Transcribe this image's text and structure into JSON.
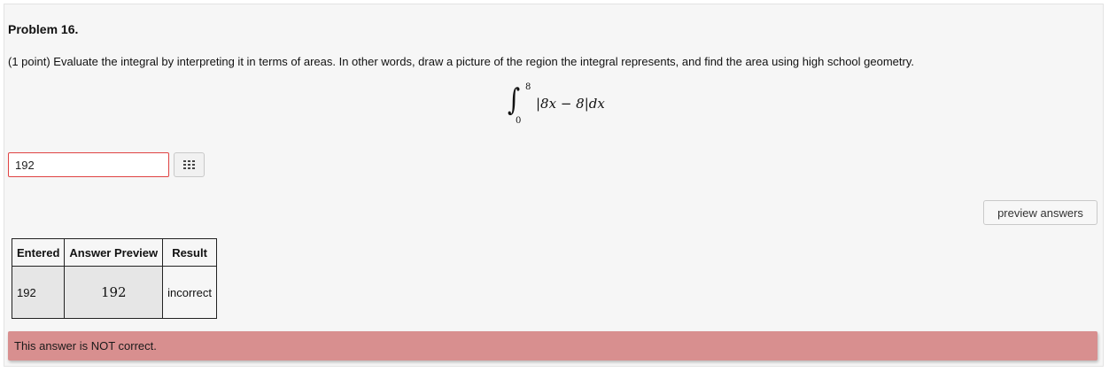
{
  "problem": {
    "title": "Problem 16.",
    "statement": "(1 point) Evaluate the integral by interpreting it in terms of areas. In other words, draw a picture of the region the integral represents, and find the area using high school geometry.",
    "integral": {
      "upper": "8",
      "lower": "0",
      "integrand": "|8x − 8|dx"
    }
  },
  "answer": {
    "value": "192",
    "palette_icon": "grid-icon"
  },
  "toolbar": {
    "preview_label": "preview answers"
  },
  "results_table": {
    "headers": [
      "Entered",
      "Answer Preview",
      "Result"
    ],
    "rows": [
      {
        "entered": "192",
        "preview": "192",
        "result": "incorrect"
      }
    ]
  },
  "feedback": {
    "message": "This answer is NOT correct.",
    "color": "#d88f8f"
  },
  "colors": {
    "input_error_border": "#e04343",
    "panel_background": "#f6f6f6"
  }
}
